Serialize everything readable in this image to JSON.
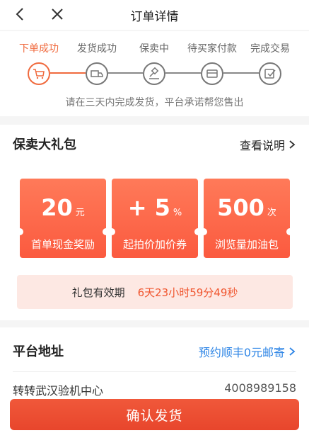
{
  "nav": {
    "title": "订单详情",
    "back_icon": "chevron-left-icon",
    "close_icon": "close-icon"
  },
  "progress": {
    "steps": [
      {
        "label": "下单成功",
        "icon": "cart-icon",
        "active": true
      },
      {
        "label": "发货成功",
        "icon": "truck-icon",
        "active": false
      },
      {
        "label": "保卖中",
        "icon": "gavel-icon",
        "active": false
      },
      {
        "label": "待买家付款",
        "icon": "wallet-icon",
        "active": false
      },
      {
        "label": "完成交易",
        "icon": "check-box-icon",
        "active": false
      }
    ],
    "note": "请在三天内完成发货，平台承诺帮您售出"
  },
  "gift": {
    "title": "保卖大礼包",
    "link": "查看说明",
    "coupons": [
      {
        "value": "20",
        "unit": "元",
        "label": "首单现金奖励"
      },
      {
        "value": "+ 5",
        "unit": "%",
        "label": "起拍价加价券"
      },
      {
        "value": "500",
        "unit": "次",
        "label": "浏览量加油包"
      }
    ],
    "validity_label": "礼包有效期",
    "validity_value": "6天23小时59分49秒"
  },
  "address": {
    "title": "平台地址",
    "link": "预约顺丰0元邮寄",
    "name": "转转武汉验机中心",
    "phone": "4008989158"
  },
  "confirm_button": "确认发货",
  "colors": {
    "accent": "#f06a3e",
    "button": "#e8462c",
    "link": "#2f86e6"
  }
}
